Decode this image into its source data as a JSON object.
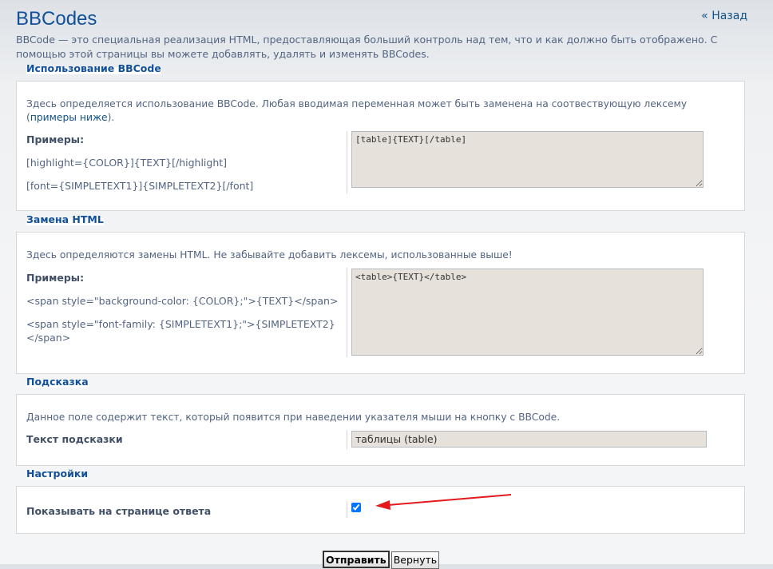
{
  "page": {
    "title": "BBCodes",
    "back_link": "« Назад",
    "intro": "BBCode — это специальная реализация HTML, предоставляющая больший контроль над тем, что и как должно быть отображено. С помощью этой страницы вы можете добавлять, удалять и изменять BBCodes."
  },
  "usage": {
    "legend": "Использование BBCode",
    "description_pre": "Здесь определяется использование BBCode. Любая вводимая переменная может быть заменена на соотвествующую лексему (",
    "description_link": "примеры ниже",
    "description_post": ").",
    "examples_label": "Примеры:",
    "examples": [
      "[highlight={COLOR}]{TEXT}[/highlight]",
      "[font={SIMPLETEXT1}]{SIMPLETEXT2}[/font]"
    ],
    "value": "[table]{TEXT}[/table]"
  },
  "html": {
    "legend": "Замена HTML",
    "description": "Здесь определяются замены HTML. Не забывайте добавить лексемы, использованные выше!",
    "examples_label": "Примеры:",
    "examples": [
      "<span style=\"background-color: {COLOR};\">{TEXT}</span>",
      "<span style=\"font-family: {SIMPLETEXT1};\">{SIMPLETEXT2}</span>"
    ],
    "value": "<table>{TEXT}</table>"
  },
  "help": {
    "legend": "Подсказка",
    "description": "Данное поле содержит текст, который появится при наведении указателя мыши на кнопку с BBCode.",
    "label": "Текст подсказки",
    "value": "таблицы (table)"
  },
  "settings": {
    "legend": "Настройки",
    "display_label": "Показывать на странице ответа",
    "display_checked": true
  },
  "buttons": {
    "submit": "Отправить",
    "reset": "Вернуть"
  },
  "colors": {
    "title": "#115098",
    "link": "#105289",
    "text": "#536482",
    "input_bg": "#e6e1da",
    "annotation_arrow": "#e3191b"
  }
}
